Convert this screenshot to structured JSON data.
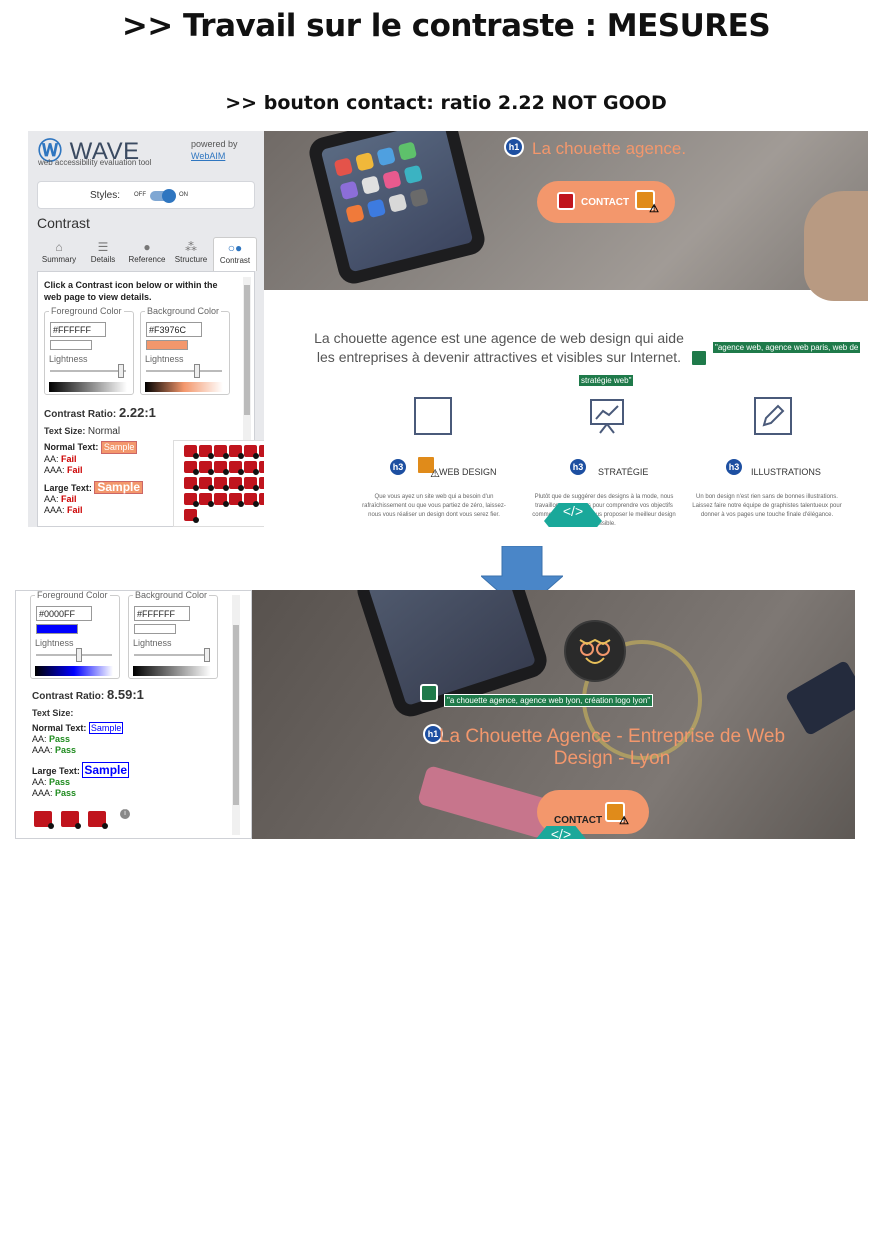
{
  "title": ">> Travail sur le contraste : MESURES",
  "subtitle": ">> bouton contact: ratio 2.22  NOT GOOD",
  "shot1": {
    "wave": {
      "logo": "WAVE",
      "tagline": "web accessibility evaluation tool",
      "powered_by": "powered by",
      "webaim": "WebAIM",
      "styles_label": "Styles:",
      "off": "OFF",
      "on": "ON",
      "section": "Contrast",
      "tabs": [
        {
          "label": "Summary",
          "icon": "home-icon"
        },
        {
          "label": "Details",
          "icon": "list-icon"
        },
        {
          "label": "Reference",
          "icon": "info-icon"
        },
        {
          "label": "Structure",
          "icon": "tree-icon"
        },
        {
          "label": "Contrast",
          "icon": "contrast-icon"
        }
      ],
      "instructions": "Click a Contrast icon below or within the web page to view details.",
      "foreground_label": "Foreground Color",
      "foreground_hex": "#FFFFFF",
      "background_label": "Background Color",
      "background_hex": "#F3976C",
      "lightness": "Lightness",
      "ratio_label": "Contrast Ratio:",
      "ratio_value": "2.22:1",
      "text_size_label": "Text Size:",
      "text_size_value": "Normal",
      "normal_text": "Normal Text:",
      "large_text": "Large Text:",
      "sample": "Sample",
      "aa": "AA:",
      "aaa": "AAA:",
      "normal_aa": "Fail",
      "normal_aaa": "Fail",
      "large_aa": "Fail",
      "large_aaa": "Fail",
      "error_icon_count": 29
    },
    "page": {
      "h1_badge": "h1",
      "heading": "La chouette agence.",
      "contact_label": "CONTACT",
      "intro": "La chouette agence est une agence de web design qui aide les entreprises à devenir attractives et visibles sur Internet.",
      "alt1": "\"agence web, agence web paris, web de",
      "alt2": "stratégie web\"",
      "h3_badge": "h3",
      "features": [
        {
          "title": "WEB DESIGN",
          "text": "Que vous ayez un site web qui a besoin d'un rafraîchissement ou que vous partiez de zéro, laissez-nous vous réaliser un design dont vous serez fier."
        },
        {
          "title": "STRATÉGIE",
          "text": "Plutôt que de suggérer des designs à la mode, nous travaillons avec vous pour comprendre vos objectifs commerciaux afin de vous proposer le meilleur design possible."
        },
        {
          "title": "ILLUSTRATIONS",
          "text": "Un bon design n'est rien sans de bonnes illustrations. Laissez faire notre équipe de graphistes talentueux pour donner à vos pages une touche finale d'élégance."
        }
      ],
      "hex_badge": "</>"
    }
  },
  "shot2": {
    "wave": {
      "foreground_label": "Foreground Color",
      "foreground_hex": "#0000FF",
      "background_label": "Background Color",
      "background_hex": "#FFFFFF",
      "lightness": "Lightness",
      "ratio_label": "Contrast Ratio:",
      "ratio_value": "8.59:1",
      "text_size_label": "Text Size:",
      "normal_text": "Normal Text:",
      "large_text": "Large Text:",
      "sample": "Sample",
      "aa": "AA:",
      "aaa": "AAA:",
      "normal_aa": "Pass",
      "normal_aaa": "Pass",
      "large_aa": "Pass",
      "large_aaa": "Pass",
      "error_icon_count": 3
    },
    "page": {
      "alt": "\"a chouette agence, agence web lyon, création logo lyon\"",
      "h1_badge": "h1",
      "heading": "La Chouette Agence - Entreprise de Web Design - Lyon",
      "contact_label": "CONTACT",
      "hex_badge": "</>"
    }
  },
  "colors": {
    "accent_orange": "#F3976C",
    "wave_blue": "#2f76c0",
    "fail": "#cc0000",
    "pass": "#1e8b1e",
    "arrow": "#4a86c8"
  }
}
